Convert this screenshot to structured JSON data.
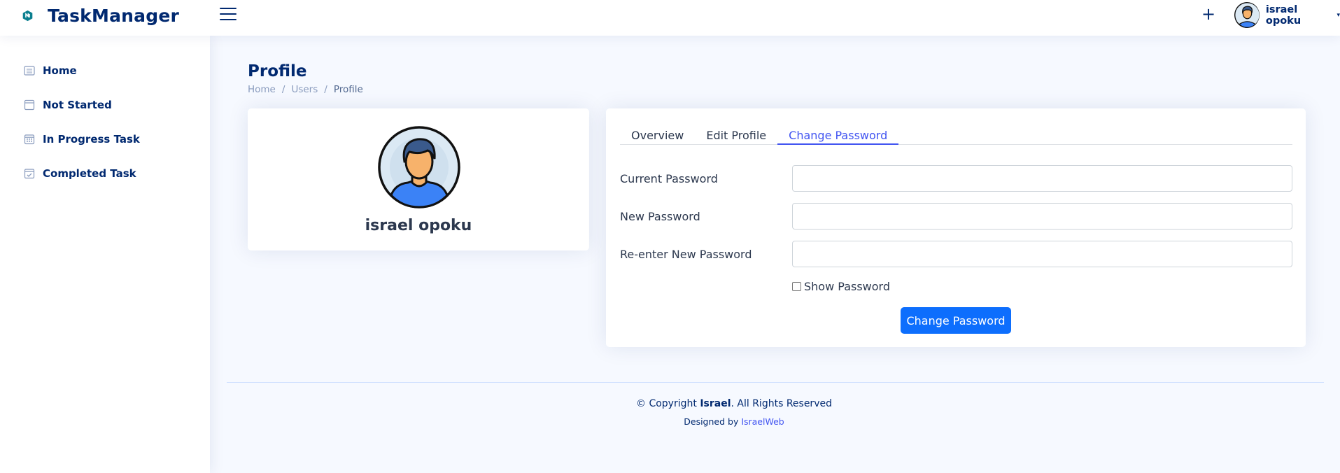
{
  "header": {
    "app_name": "TaskManager",
    "logo_icon": "logo-mark",
    "menu_icon": "hamburger-icon",
    "add_icon": "plus-icon",
    "add_label": "+",
    "user_name": "israel opoku",
    "caret": "▾"
  },
  "sidebar": {
    "items": [
      {
        "label": "Home",
        "icon": "list-icon"
      },
      {
        "label": "Not Started",
        "icon": "window-icon"
      },
      {
        "label": "In Progress Task",
        "icon": "calendar-grid-icon"
      },
      {
        "label": "Completed Task",
        "icon": "calendar-check-icon"
      }
    ]
  },
  "page": {
    "title": "Profile",
    "breadcrumb": [
      "Home",
      "Users",
      "Profile"
    ],
    "breadcrumb_sep": "/"
  },
  "profile_card": {
    "name": "israel opoku"
  },
  "tabs": [
    {
      "label": "Overview",
      "active": false
    },
    {
      "label": "Edit Profile",
      "active": false
    },
    {
      "label": "Change Password",
      "active": true
    }
  ],
  "form": {
    "current_password_label": "Current Password",
    "current_password_value": "",
    "new_password_label": "New Password",
    "new_password_value": "",
    "reenter_label": "Re-enter New Password",
    "reenter_value": "",
    "show_password_label": "Show Password",
    "show_password_checked": false,
    "submit_label": "Change Password"
  },
  "footer": {
    "copyright_prefix": "© Copyright ",
    "copyright_name": "Israel",
    "copyright_suffix": ". All Rights Reserved",
    "designed_by": "Designed by ",
    "designer": "IsraelWeb"
  },
  "colors": {
    "primary": "#4154f1",
    "button": "#0d6efd",
    "brand_navy": "#012970",
    "background": "#f6f9ff"
  }
}
